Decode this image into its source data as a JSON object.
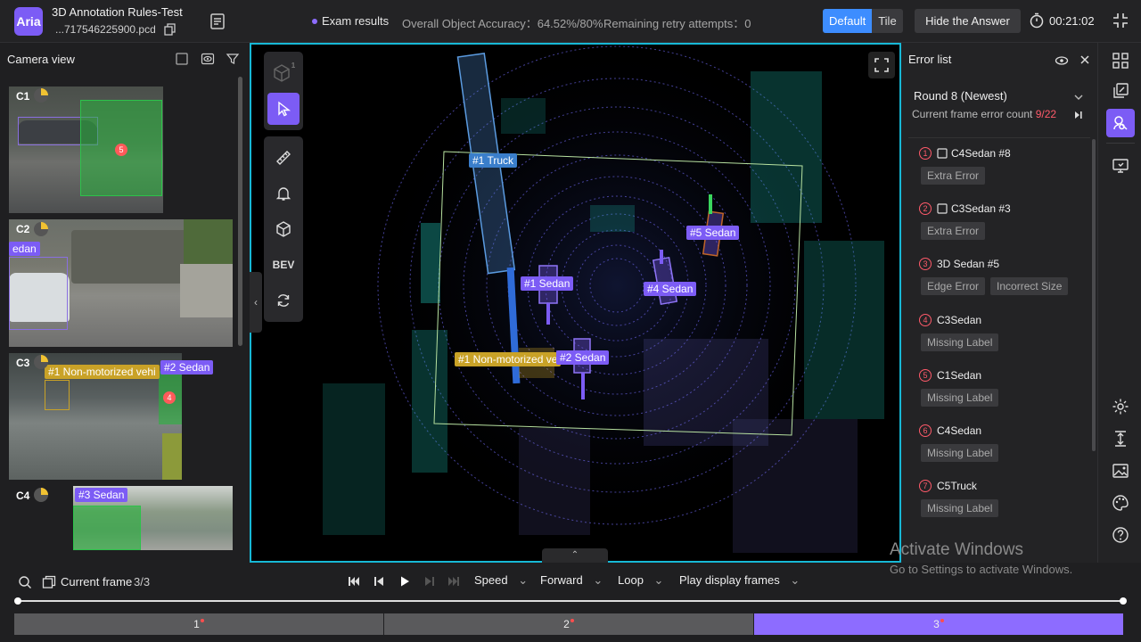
{
  "header": {
    "logo": "Aria",
    "task_title": "3D Annotation Rules-Test",
    "file_name": "...717546225900.pcd",
    "exam_results": "Exam results",
    "overall_accuracy": "Overall Object Accuracy：64.52%/80%",
    "remaining_retry": "Remaining retry attempts：0",
    "view_modes": [
      "Default",
      "Tile"
    ],
    "active_view_mode": "Default",
    "hide_answer": "Hide the Answer",
    "timer": "00:21:02"
  },
  "camera_view": {
    "title": "Camera view",
    "cameras": [
      {
        "label": "C1",
        "tags": []
      },
      {
        "label": "C2",
        "tags": [
          "edan"
        ]
      },
      {
        "label": "C3",
        "tags": [
          "#1 Non-motorized vehi",
          "#2 Sedan"
        ]
      },
      {
        "label": "C4",
        "tags": [
          "#3 Sedan"
        ]
      }
    ],
    "badges": [
      "5",
      "4"
    ]
  },
  "viewport": {
    "toolbar": {
      "bev_label": "BEV",
      "cube_superscript": "1"
    },
    "annotations": [
      {
        "label": "#1 Truck"
      },
      {
        "label": "#5 Sedan"
      },
      {
        "label": "#1 Sedan"
      },
      {
        "label": "#4 Sedan"
      },
      {
        "label": "#1 Non-motorized ve"
      },
      {
        "label": "#2 Sedan"
      }
    ]
  },
  "error_list": {
    "title": "Error list",
    "round": "Round 8  (Newest)",
    "current_count_label": "Current frame error count ",
    "current_count_value": "9/22",
    "items": [
      {
        "num": "1",
        "name": "C4Sedan  #8",
        "chips": [
          "Extra Error"
        ]
      },
      {
        "num": "2",
        "name": "C3Sedan  #3",
        "chips": [
          "Extra Error"
        ]
      },
      {
        "num": "3",
        "name": "3D Sedan  #5",
        "chips": [
          "Edge Error",
          "Incorrect Size"
        ]
      },
      {
        "num": "4",
        "name": "C3Sedan",
        "chips": [
          "Missing Label"
        ]
      },
      {
        "num": "5",
        "name": "C1Sedan",
        "chips": [
          "Missing Label"
        ]
      },
      {
        "num": "6",
        "name": "C4Sedan",
        "chips": [
          "Missing Label"
        ]
      },
      {
        "num": "7",
        "name": "C5Truck",
        "chips": [
          "Missing Label"
        ]
      }
    ]
  },
  "playback": {
    "current_frame_label": "Current frame",
    "current_frame_value": "3/3",
    "speed": "Speed",
    "direction": "Forward",
    "loop": "Loop",
    "play_display_frames": "Play display frames",
    "frames": [
      "1",
      "2",
      "3"
    ],
    "active_frame": "3"
  },
  "watermark": {
    "line1": "Activate Windows",
    "line2": "Go to Settings to activate Windows."
  },
  "colors": {
    "accent": "#7c5cf5",
    "viewport_border": "#17b8d6",
    "error_red": "#ff5a6a",
    "tile_blue": "#3d8dff"
  }
}
